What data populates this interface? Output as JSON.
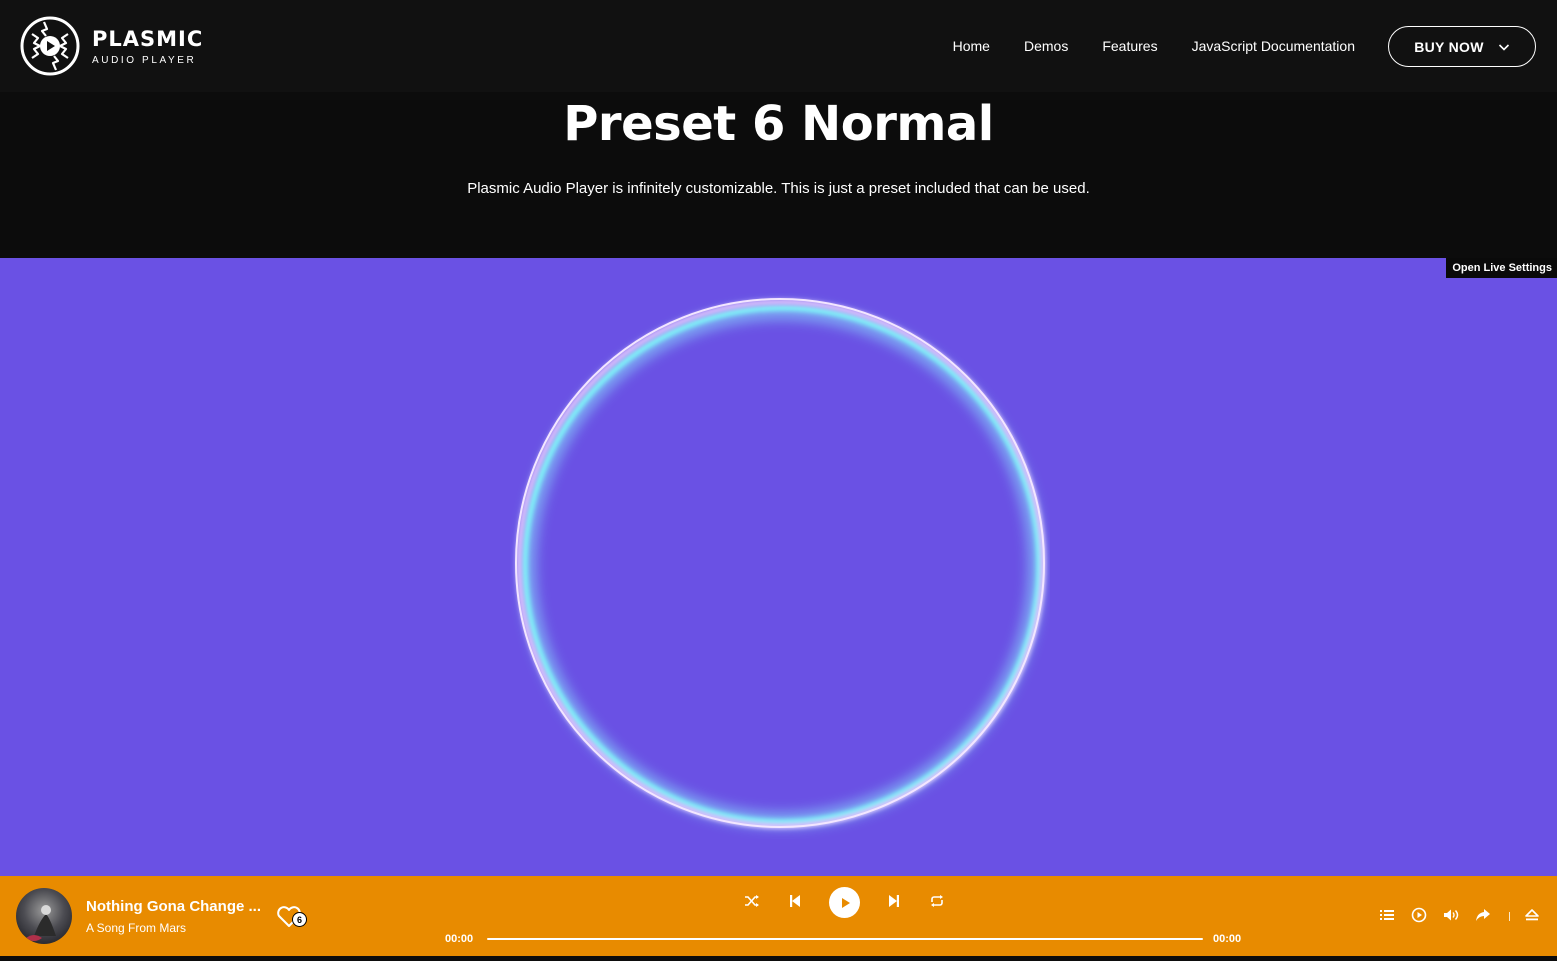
{
  "brand": {
    "title": "PLASMIC",
    "subtitle": "AUDIO PLAYER"
  },
  "nav": {
    "items": [
      "Home",
      "Demos",
      "Features",
      "JavaScript Documentation"
    ],
    "buy_label": "BUY NOW"
  },
  "hero": {
    "title": "Preset 6 Normal",
    "description": "Plasmic Audio Player is infinitely customizable. This is just a preset included that can be used."
  },
  "visualizer": {
    "live_settings_label": "Open Live Settings",
    "background_color": "#6a51e4"
  },
  "player": {
    "track_title": "Nothing Gona Change ...",
    "track_artist": "A Song From Mars",
    "like_count": "6",
    "current_time": "00:00",
    "total_time": "00:00",
    "progress": 0,
    "bar_color": "#e88b00",
    "icons": {
      "left": [
        "heart-icon"
      ],
      "center": [
        "shuffle-icon",
        "previous-icon",
        "play-icon",
        "next-icon",
        "repeat-icon"
      ],
      "right": [
        "playlist-icon",
        "autoplay-icon",
        "volume-icon",
        "share-icon",
        "eject-icon"
      ]
    }
  }
}
